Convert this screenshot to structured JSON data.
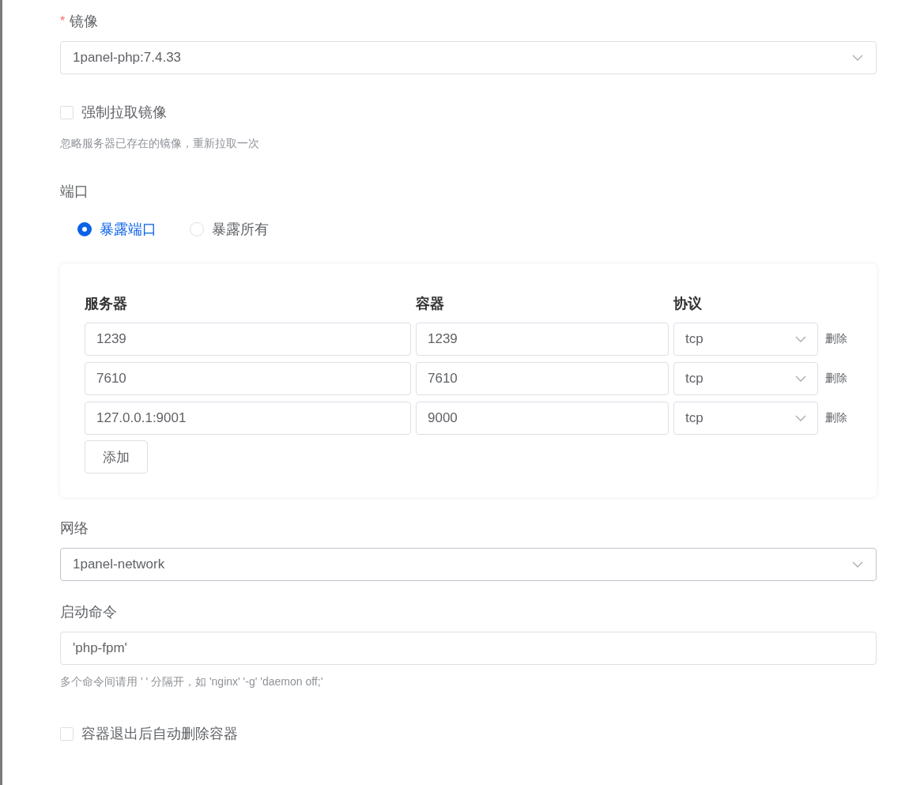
{
  "image": {
    "label": "镜像",
    "required_mark": "*",
    "value": "1panel-php:7.4.33"
  },
  "force_pull": {
    "label": "强制拉取镜像",
    "checked": false,
    "hint": "忽略服务器已存在的镜像，重新拉取一次"
  },
  "ports": {
    "label": "端口",
    "modes": [
      {
        "label": "暴露端口",
        "selected": true
      },
      {
        "label": "暴露所有",
        "selected": false
      }
    ],
    "columns": [
      "服务器",
      "容器",
      "协议"
    ],
    "rows": [
      {
        "server": "1239",
        "container": "1239",
        "protocol": "tcp",
        "action": "删除"
      },
      {
        "server": "7610",
        "container": "7610",
        "protocol": "tcp",
        "action": "删除"
      },
      {
        "server": "127.0.0.1:9001",
        "container": "9000",
        "protocol": "tcp",
        "action": "删除"
      }
    ],
    "add_button": "添加"
  },
  "network": {
    "label": "网络",
    "value": "1panel-network"
  },
  "command": {
    "label": "启动命令",
    "value": "'php-fpm'",
    "hint": "多个命令间请用 ' ' 分隔开，如 'nginx' '-g' 'daemon off;'"
  },
  "auto_remove": {
    "label": "容器退出后自动删除容器",
    "checked": false
  }
}
